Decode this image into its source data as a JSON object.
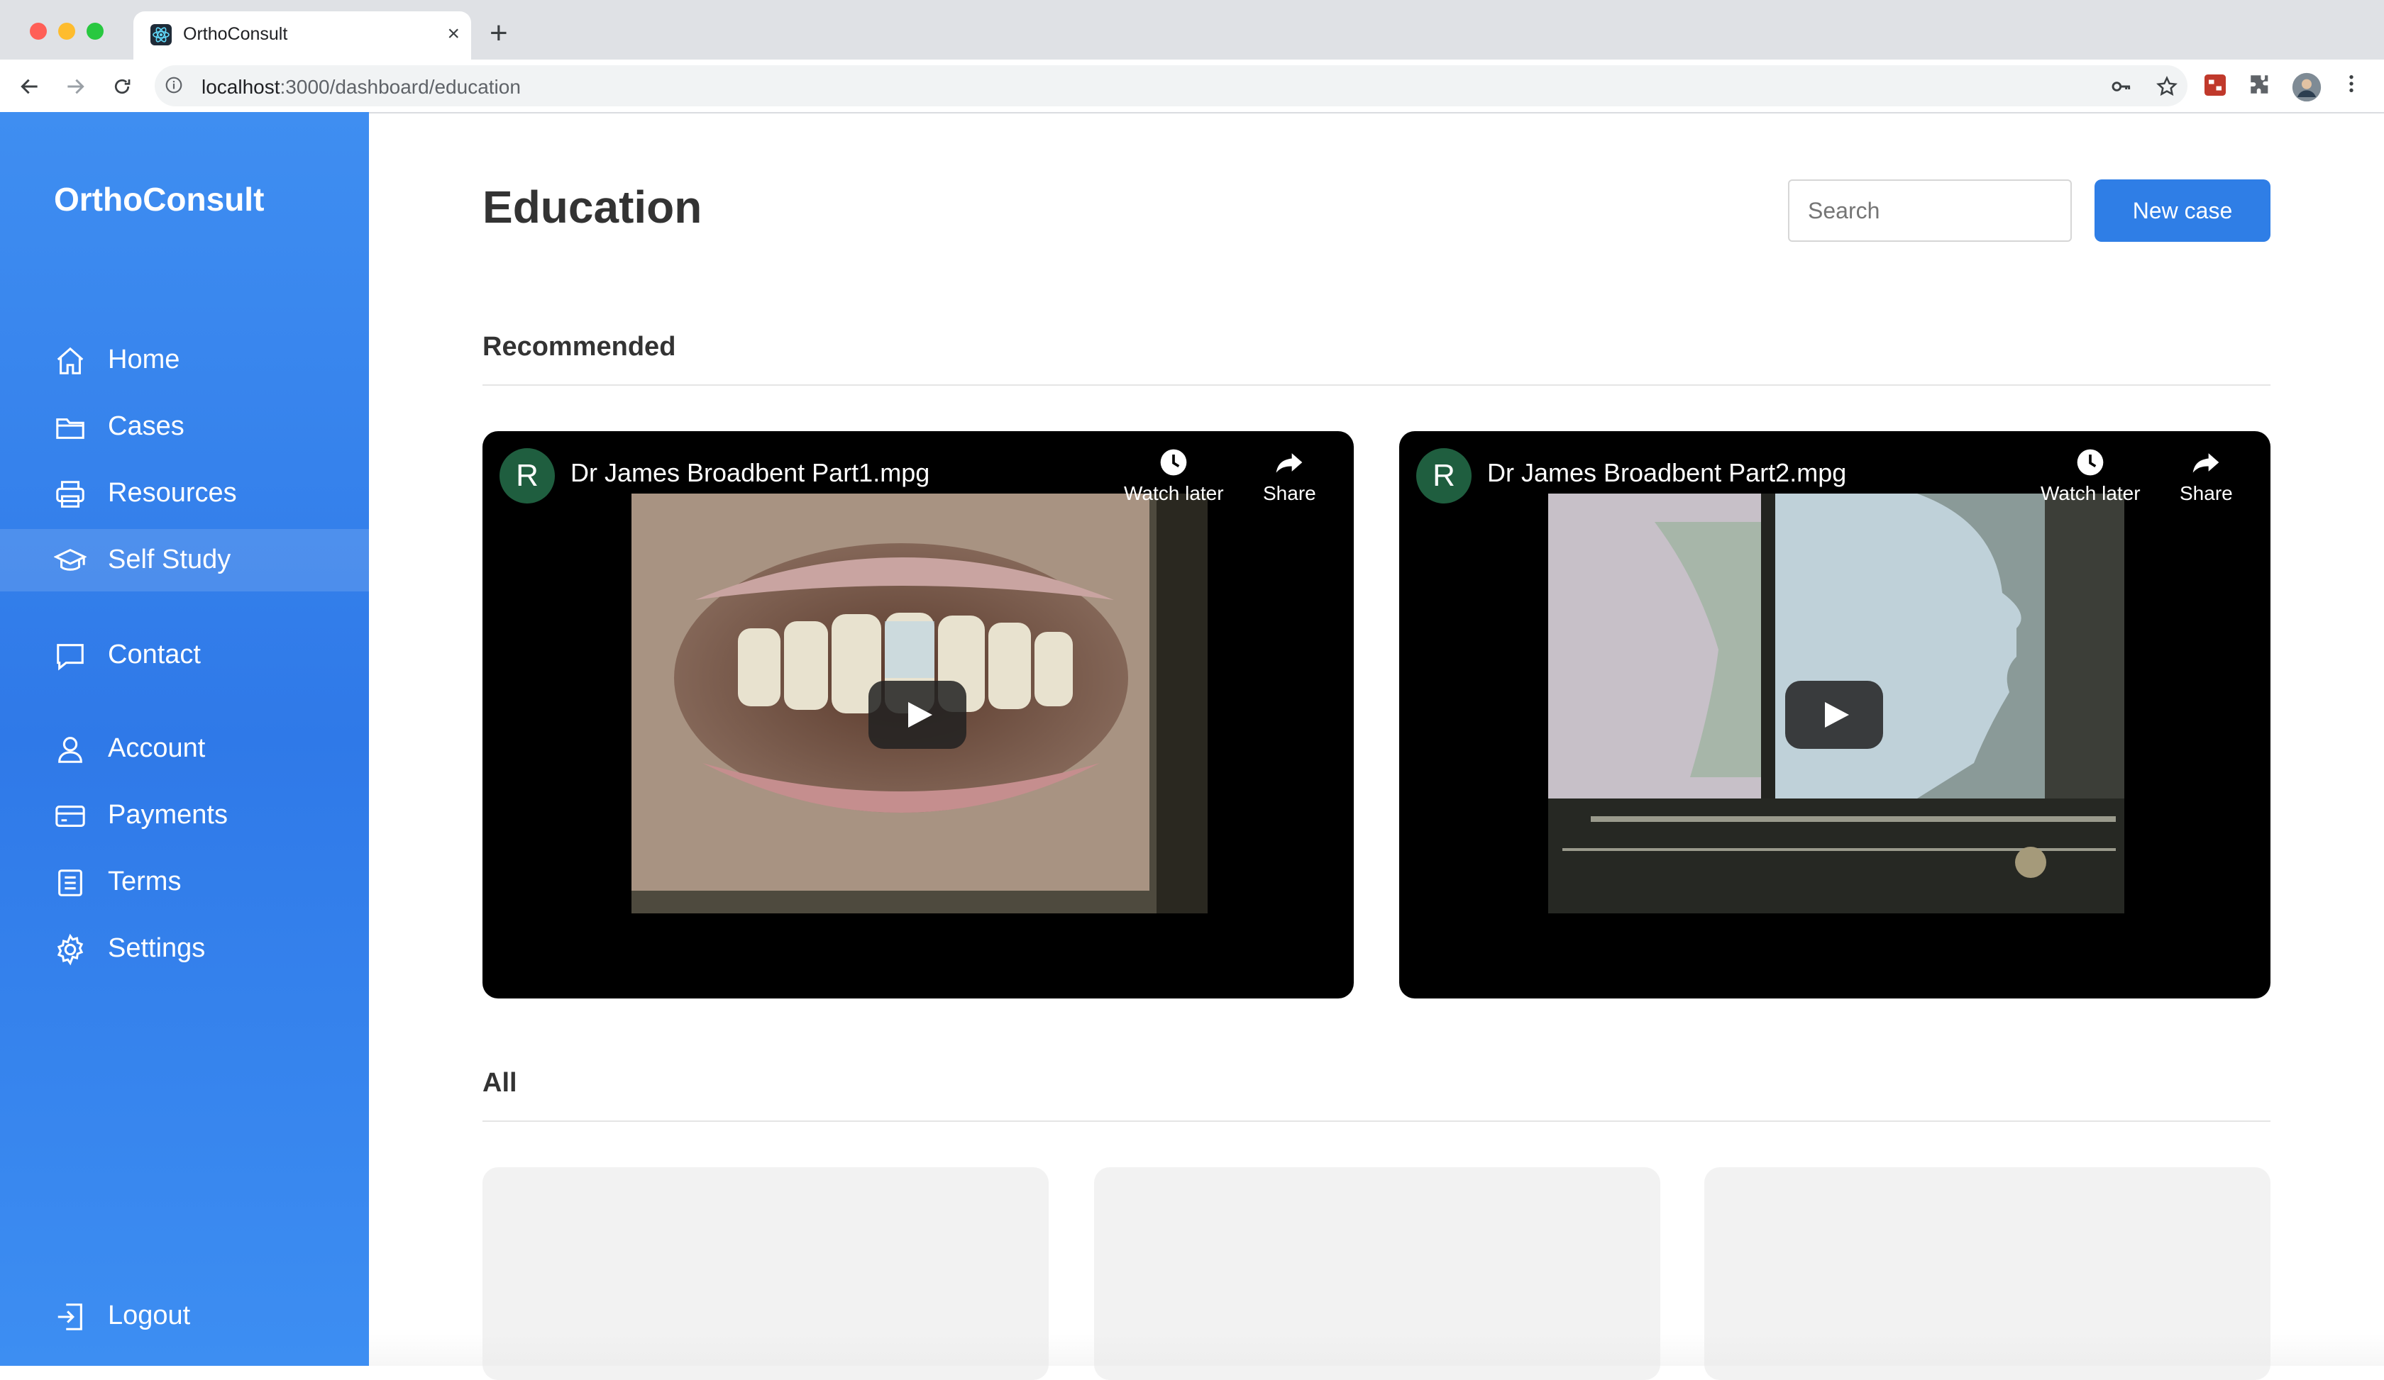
{
  "browser": {
    "tab_title": "OrthoConsult",
    "new_tab": "+",
    "close": "×",
    "url_host": "localhost",
    "url_path": ":3000/dashboard/education"
  },
  "sidebar": {
    "brand": "OrthoConsult",
    "items": [
      {
        "label": "Home",
        "icon": "home-icon"
      },
      {
        "label": "Cases",
        "icon": "folder-icon"
      },
      {
        "label": "Resources",
        "icon": "printer-icon"
      },
      {
        "label": "Self Study",
        "icon": "graduation-cap-icon",
        "active": true
      },
      {
        "label": "Contact",
        "icon": "chat-icon"
      },
      {
        "label": "Account",
        "icon": "user-icon"
      },
      {
        "label": "Payments",
        "icon": "credit-card-icon"
      },
      {
        "label": "Terms",
        "icon": "document-icon"
      },
      {
        "label": "Settings",
        "icon": "gear-icon"
      }
    ],
    "logout": "Logout"
  },
  "header": {
    "title": "Education",
    "search_placeholder": "Search",
    "new_case_label": "New case"
  },
  "sections": {
    "recommended": "Recommended",
    "all": "All"
  },
  "videos": [
    {
      "avatar": "R",
      "title": "Dr James Broadbent Part1.mpg",
      "watch_later": "Watch later",
      "share": "Share"
    },
    {
      "avatar": "R",
      "title": "Dr James Broadbent Part2.mpg",
      "watch_later": "Watch later",
      "share": "Share"
    }
  ],
  "colors": {
    "sidebar": "#3385ee",
    "primary_button": "#2f7ee6",
    "avatar": "#1f5e3f"
  }
}
